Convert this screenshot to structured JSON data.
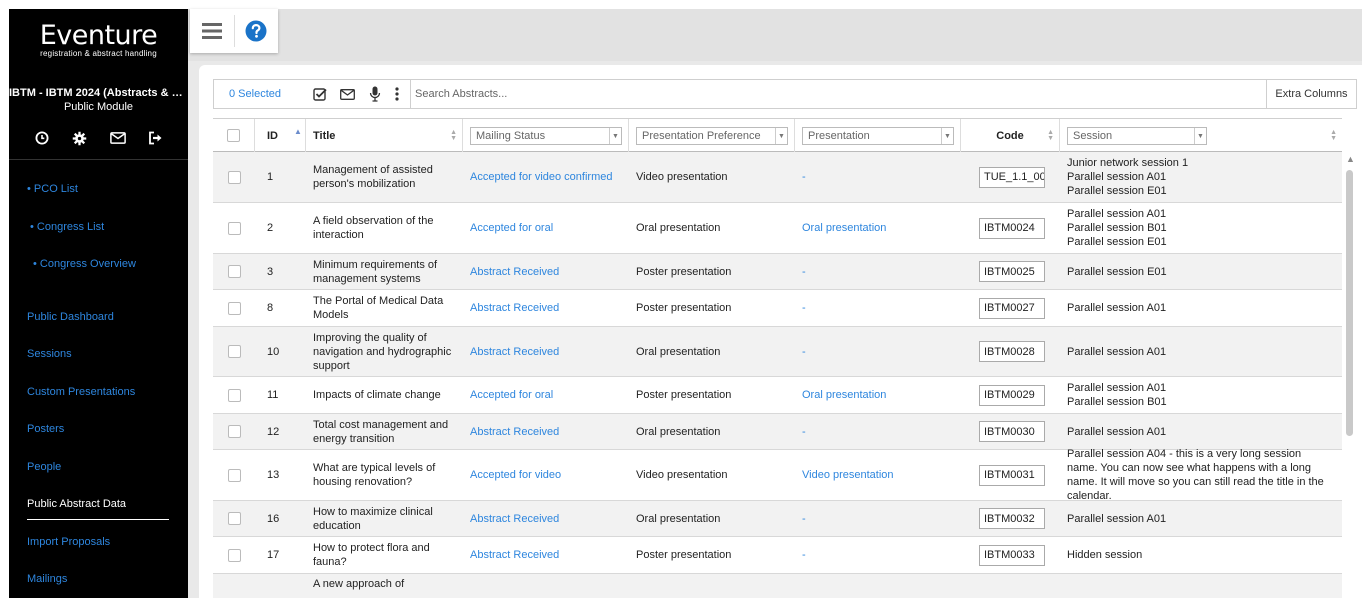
{
  "brand": {
    "name": "Eventure",
    "tagline": "registration & abstract handling"
  },
  "event": {
    "name": "IBTM - IBTM 2024 (Abstracts & Par...",
    "module": "Public Module"
  },
  "sidebar_icons": [
    "clock-icon",
    "gear-icon",
    "mail-icon",
    "logout-icon"
  ],
  "nav": {
    "pco_list": "• PCO List",
    "congress_list": "• Congress List",
    "congress_overview": "• Congress Overview",
    "public_dashboard": "Public Dashboard",
    "sessions": "Sessions",
    "custom_presentations": "Custom Presentations",
    "posters": "Posters",
    "people": "People",
    "public_abstract_data": "Public Abstract Data",
    "import_proposals": "Import Proposals",
    "mailings": "Mailings"
  },
  "toolbar": {
    "selected": "0 Selected",
    "search_placeholder": "Search Abstracts...",
    "extra_columns": "Extra Columns"
  },
  "columns": {
    "id": "ID",
    "title": "Title",
    "mailing_status": "Mailing Status",
    "presentation_preference": "Presentation Preference",
    "presentation": "Presentation",
    "code": "Code",
    "session": "Session"
  },
  "rows": [
    {
      "id": "1",
      "title": "Management of assisted person's mobilization",
      "mailing": "Accepted for video confirmed",
      "pref": "Video presentation",
      "presentation": "-",
      "code": "TUE_1.1_00",
      "session": "Junior network session 1\nParallel session A01\nParallel session E01"
    },
    {
      "id": "2",
      "title": "A field observation of the interaction",
      "mailing": "Accepted for oral",
      "pref": "Oral presentation",
      "presentation": "Oral presentation",
      "code": "IBTM0024",
      "session": "Parallel session A01\nParallel session B01\nParallel session E01"
    },
    {
      "id": "3",
      "title": "Minimum requirements of management systems",
      "mailing": "Abstract Received",
      "pref": "Poster presentation",
      "presentation": "-",
      "code": "IBTM0025",
      "session": "Parallel session E01"
    },
    {
      "id": "8",
      "title": "The Portal of Medical Data Models",
      "mailing": "Abstract Received",
      "pref": "Poster presentation",
      "presentation": "-",
      "code": "IBTM0027",
      "session": "Parallel session A01"
    },
    {
      "id": "10",
      "title": "Improving the quality of navigation and hydrographic support",
      "mailing": "Abstract Received",
      "pref": "Oral presentation",
      "presentation": "-",
      "code": "IBTM0028",
      "session": "Parallel session A01"
    },
    {
      "id": "11",
      "title": "Impacts of climate change",
      "mailing": "Accepted for oral",
      "pref": "Poster presentation",
      "presentation": "Oral presentation",
      "code": "IBTM0029",
      "session": "Parallel session A01\nParallel session B01"
    },
    {
      "id": "12",
      "title": "Total cost management and energy transition",
      "mailing": "Abstract Received",
      "pref": "Oral presentation",
      "presentation": "-",
      "code": "IBTM0030",
      "session": "Parallel session A01"
    },
    {
      "id": "13",
      "title": "What are typical levels of housing renovation?",
      "mailing": "Accepted for video",
      "pref": "Video presentation",
      "presentation": "Video presentation",
      "code": "IBTM0031",
      "session": "Parallel session A04 - this is a very long session name. You can now see what happens with a long name. It will move so you can still read the title in the calendar."
    },
    {
      "id": "16",
      "title": "How to maximize clinical education",
      "mailing": "Abstract Received",
      "pref": "Oral presentation",
      "presentation": "-",
      "code": "IBTM0032",
      "session": "Parallel session A01"
    },
    {
      "id": "17",
      "title": "How to protect flora and fauna?",
      "mailing": "Abstract Received",
      "pref": "Poster presentation",
      "presentation": "-",
      "code": "IBTM0033",
      "session": "Hidden session"
    },
    {
      "id": "",
      "title": "A new approach of",
      "mailing": "",
      "pref": "",
      "presentation": "",
      "code": "",
      "session": ""
    }
  ],
  "colors": {
    "accent": "#2e86de",
    "help": "#1a73c8",
    "sidebar": "#000000"
  }
}
